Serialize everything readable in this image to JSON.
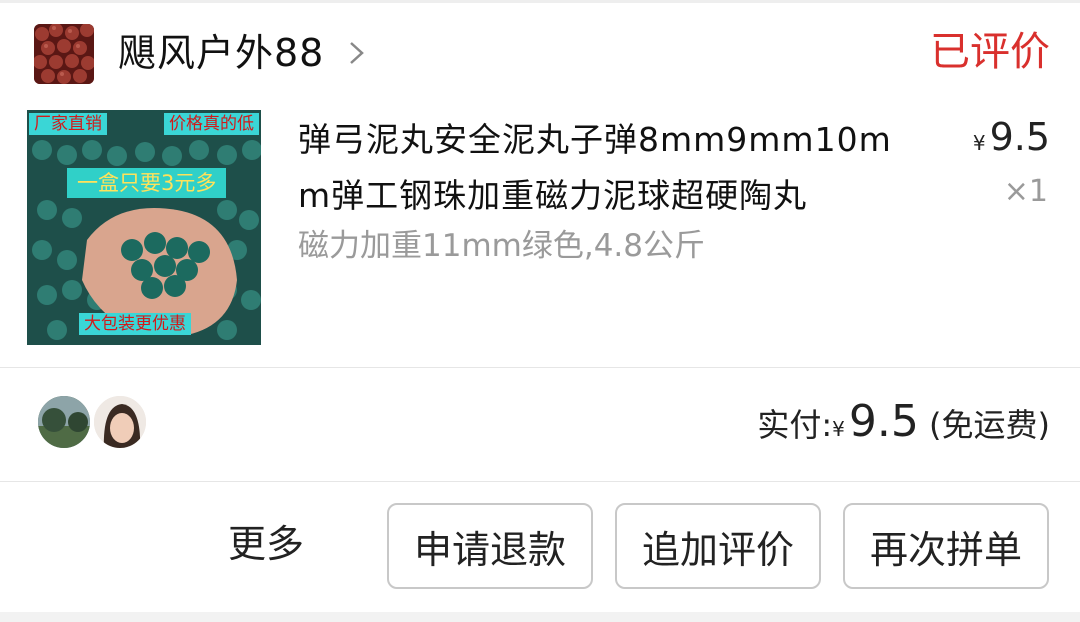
{
  "shop": {
    "name": "飓风户外88",
    "status": "已评价"
  },
  "product": {
    "title": "弹弓泥丸安全泥丸子弹8mm9mm10mm弹工钢珠加重磁力泥球超硬陶丸",
    "variant": "磁力加重11mm绿色,4.8公斤",
    "currency": "¥",
    "price": "9.5",
    "quantity": "×1",
    "image_tags": {
      "top_left": "厂家直销",
      "top_right": "价格真的低",
      "middle": "一盒只要3元多",
      "bottom": "大包装更优惠"
    }
  },
  "payment": {
    "label": "实付:",
    "currency": "¥",
    "amount": "9.5",
    "note": "(免运费)"
  },
  "actions": {
    "more": "更多",
    "refund": "申请退款",
    "add_review": "追加评价",
    "reorder": "再次拼单"
  },
  "colors": {
    "status": "#d9302d",
    "muted": "#9a9a9a"
  }
}
